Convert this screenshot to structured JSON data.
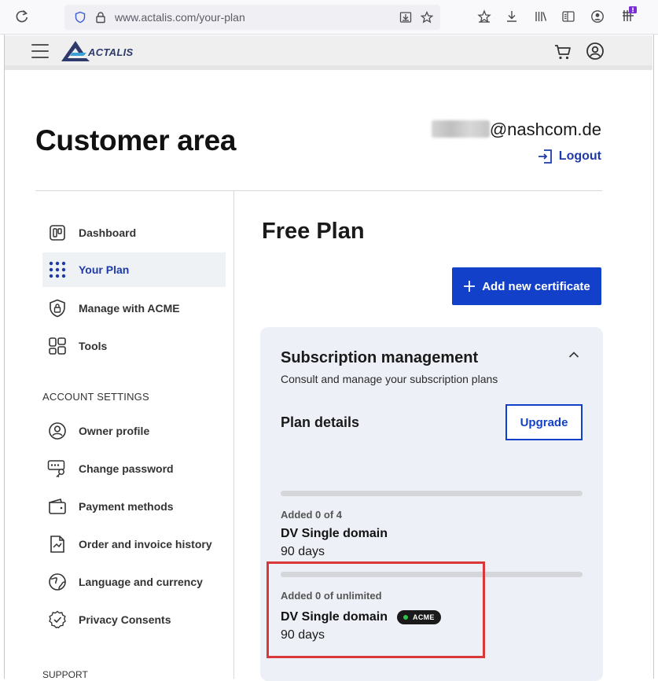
{
  "browser": {
    "url": "www.actalis.com/your-plan"
  },
  "header": {
    "logo_text": "ACTALIS"
  },
  "account": {
    "email_visible": "@nashcom.de",
    "logout_label": "Logout"
  },
  "page": {
    "title": "Customer area"
  },
  "sidebar": {
    "items": [
      {
        "label": "Dashboard",
        "icon": "dashboard-icon"
      },
      {
        "label": "Your Plan",
        "icon": "grid-dots-icon",
        "active": true
      },
      {
        "label": "Manage with ACME",
        "icon": "shield-lock-icon"
      },
      {
        "label": "Tools",
        "icon": "tools-grid-icon"
      }
    ],
    "account_settings_label": "ACCOUNT SETTINGS",
    "settings_items": [
      {
        "label": "Owner profile",
        "icon": "user-circle-icon"
      },
      {
        "label": "Change password",
        "icon": "key-icon"
      },
      {
        "label": "Payment methods",
        "icon": "wallet-icon"
      },
      {
        "label": "Order and invoice history",
        "icon": "invoice-icon"
      },
      {
        "label": "Language and currency",
        "icon": "globe-icon"
      },
      {
        "label": "Privacy Consents",
        "icon": "badge-check-icon"
      }
    ],
    "support_label": "SUPPORT"
  },
  "main": {
    "plan_title": "Free Plan",
    "add_button_label": "Add new certificate",
    "subscription": {
      "title": "Subscription management",
      "subtitle": "Consult and manage your subscription plans",
      "plan_details_label": "Plan details",
      "upgrade_label": "Upgrade",
      "plans": [
        {
          "added": "Added 0 of 4",
          "product": "DV Single domain",
          "duration": "90 days",
          "progress": 0
        },
        {
          "added": "Added 0 of unlimited",
          "product": "DV Single domain",
          "duration": "90 days",
          "progress": 0,
          "badge": "ACME"
        }
      ]
    }
  },
  "colors": {
    "accent": "#1340c8",
    "highlight_box": "#d9383a",
    "badge_dot": "#2ec44a"
  }
}
